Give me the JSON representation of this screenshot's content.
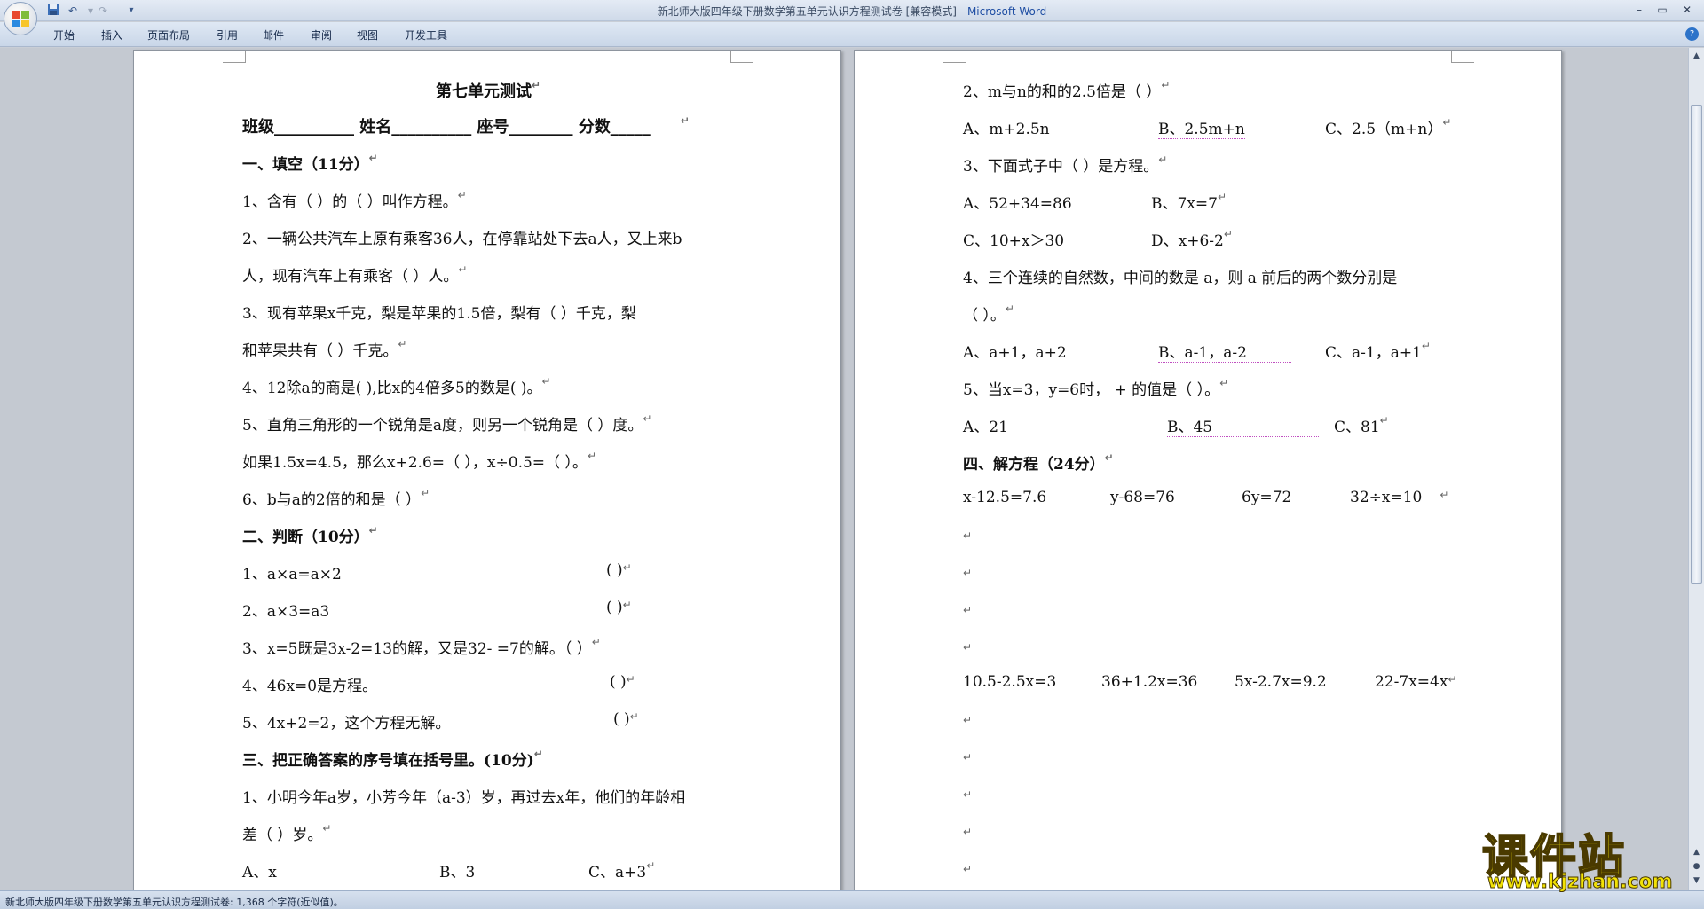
{
  "window": {
    "title": "新北师大版四年级下册数学第五单元认识方程测试卷 [兼容模式]",
    "title_sep": " - ",
    "app_name": "Microsoft Word",
    "controls": [
      "–",
      "▭",
      "✕"
    ]
  },
  "quick_access": {
    "save_icon": "save-icon",
    "undo_icon": "undo-icon",
    "redo_icon": "redo-icon",
    "more_icon": "▾"
  },
  "tabs": [
    "开始",
    "插入",
    "页面布局",
    "引用",
    "邮件",
    "审阅",
    "视图",
    "开发工具"
  ],
  "left_page": {
    "title": "第七单元测试",
    "header_line": "班级__________      姓名__________     座号________     分数_____",
    "lines": [
      {
        "text": "一、填空（11分）",
        "bold": true
      },
      {
        "text": "1、含有（          ）的（         ）叫作方程。"
      },
      {
        "text": "2、一辆公共汽车上原有乘客36人，在停靠站处下去a人，又上来b"
      },
      {
        "text": "人，现有汽车上有乘客（             ）人。"
      },
      {
        "text": "3、现有苹果x千克，梨是苹果的1.5倍，梨有（        ）千克，梨"
      },
      {
        "text": "和苹果共有（            ）千克。"
      },
      {
        "text": "4、12除a的商是(             ),比x的4倍多5的数是(            )。"
      },
      {
        "text": "5、直角三角形的一个锐角是a度，则另一个锐角是（             ）度。"
      },
      {
        "text": "如果1.5x=4.5，那么x+2.6=（         ），x÷0.5=（        ）。"
      },
      {
        "text": "6、b与a的2倍的和是（              ）"
      },
      {
        "text": "二、判断（10分）",
        "bold": true
      },
      {
        "text": "1、a×a=a×2",
        "paren": "(      )"
      },
      {
        "text": "2、a×3=a3",
        "paren": "(      )"
      },
      {
        "text": "3、x=5既是3x-2=13的解，又是32-   =7的解。（      ）"
      },
      {
        "text": "4、46x=0是方程。",
        "paren": "(      )"
      },
      {
        "text": "5、4x+2=2，这个方程无解。",
        "paren": "(      )"
      },
      {
        "text": "三、把正确答案的序号填在括号里。(10分)",
        "bold": true
      },
      {
        "text": "1、小明今年a岁，小芳今年（a-3）岁，再过去x年，他们的年龄相"
      },
      {
        "text": "差（        ）岁。"
      },
      {
        "text": "A、x",
        "b": "B、3",
        "c": "C、a+3"
      }
    ]
  },
  "right_page": {
    "lines": [
      {
        "text": "2、m与n的和的2.5倍是（         ）"
      },
      {
        "text": "A、m+2.5n",
        "b": "B、2.5m+n",
        "c": "C、2.5（m+n）"
      },
      {
        "text": "3、下面式子中（      ）是方程。"
      },
      {
        "text": "A、52+34=86",
        "b": "B、7x=7"
      },
      {
        "text": "C、10+x＞30",
        "b": "D、x+6-2"
      },
      {
        "text": "4、三个连续的自然数，中间的数是 a，则 a 前后的两个数分别是"
      },
      {
        "text": "（       ）。"
      },
      {
        "text": "A、a+1，a+2",
        "b": "B、a-1，a-2",
        "c": "C、a-1，a+1"
      },
      {
        "text": "5、当x=3，y=6时，   +    的值是（        ）。"
      },
      {
        "text": "A、21",
        "b": "B、45",
        "c": "C、81"
      },
      {
        "text": "四、解方程（24分）",
        "bold": true
      },
      {
        "eqs": [
          "x-12.5=7.6",
          "y-68=76",
          "6y=72",
          "32÷x=10"
        ]
      },
      {
        "eqs": [
          "10.5-2.5x=3",
          "36+1.2x=36",
          "5x-2.7x=9.2",
          "22-7x=4x"
        ]
      }
    ]
  },
  "status": {
    "text": "新北师大版四年级下册数学第五单元认识方程测试卷: 1,368 个字符(近似值)。"
  },
  "watermark": {
    "title": "课件站",
    "url": "www.kjzhan.com"
  },
  "paragraph_mark": "↵"
}
